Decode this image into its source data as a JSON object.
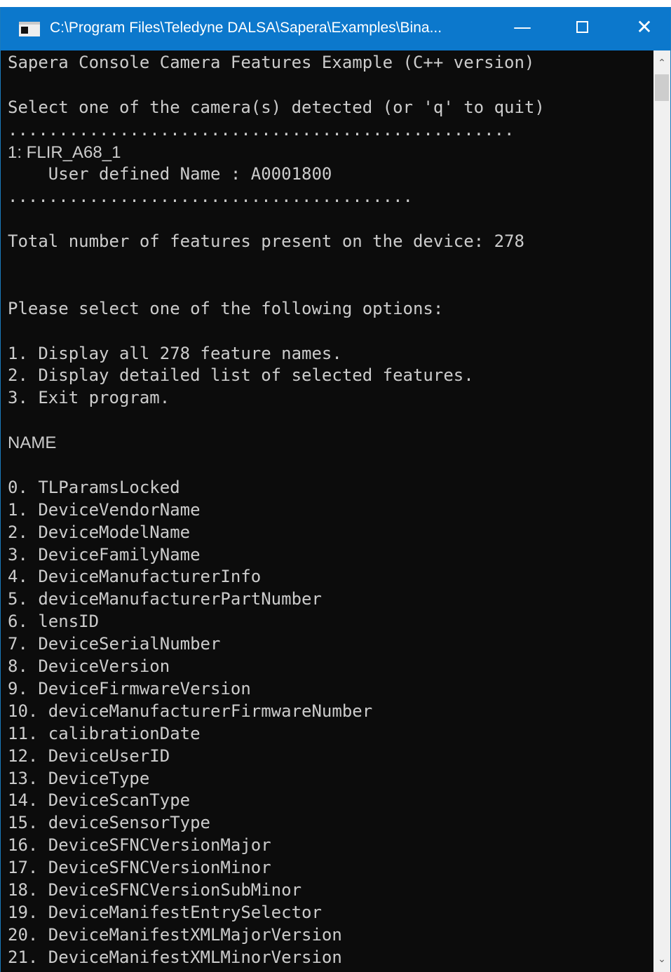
{
  "window": {
    "title": "C:\\Program Files\\Teledyne DALSA\\Sapera\\Examples\\Bina...",
    "min_glyph": "—",
    "close_glyph": "✕",
    "icon": "console-window-icon"
  },
  "console": {
    "lines": [
      "Sapera Console Camera Features Example (C++ version)",
      "",
      "Select one of the camera(s) detected (or 'q' to quit)",
      "..................................................",
      "1: FLIR_A68_1",
      "    User defined Name : A0001800",
      "........................................",
      "",
      "Total number of features present on the device: 278",
      "",
      "",
      "Please select one of the following options:",
      "",
      "1. Display all 278 feature names.",
      "2. Display detailed list of selected features.",
      "3. Exit program.",
      "",
      "NAME",
      "",
      "0. TLParamsLocked",
      "1. DeviceVendorName",
      "2. DeviceModelName",
      "3. DeviceFamilyName",
      "4. DeviceManufacturerInfo",
      "5. deviceManufacturerPartNumber",
      "6. lensID",
      "7. DeviceSerialNumber",
      "8. DeviceVersion",
      "9. DeviceFirmwareVersion",
      "10. deviceManufacturerFirmwareNumber",
      "11. calibrationDate",
      "12. DeviceUserID",
      "13. DeviceType",
      "14. DeviceScanType",
      "15. deviceSensorType",
      "16. DeviceSFNCVersionMajor",
      "17. DeviceSFNCVersionMinor",
      "18. DeviceSFNCVersionSubMinor",
      "19. DeviceManifestEntrySelector",
      "20. DeviceManifestXMLMajorVersion",
      "21. DeviceManifestXMLMinorVersion"
    ]
  },
  "scrollbar": {
    "up_glyph": "⌃",
    "down_glyph": "⌄",
    "position_fraction": 0.0
  },
  "colors": {
    "titlebar": "#0c78cc",
    "console_bg": "#0c0c0c",
    "console_text": "#cccccc"
  }
}
